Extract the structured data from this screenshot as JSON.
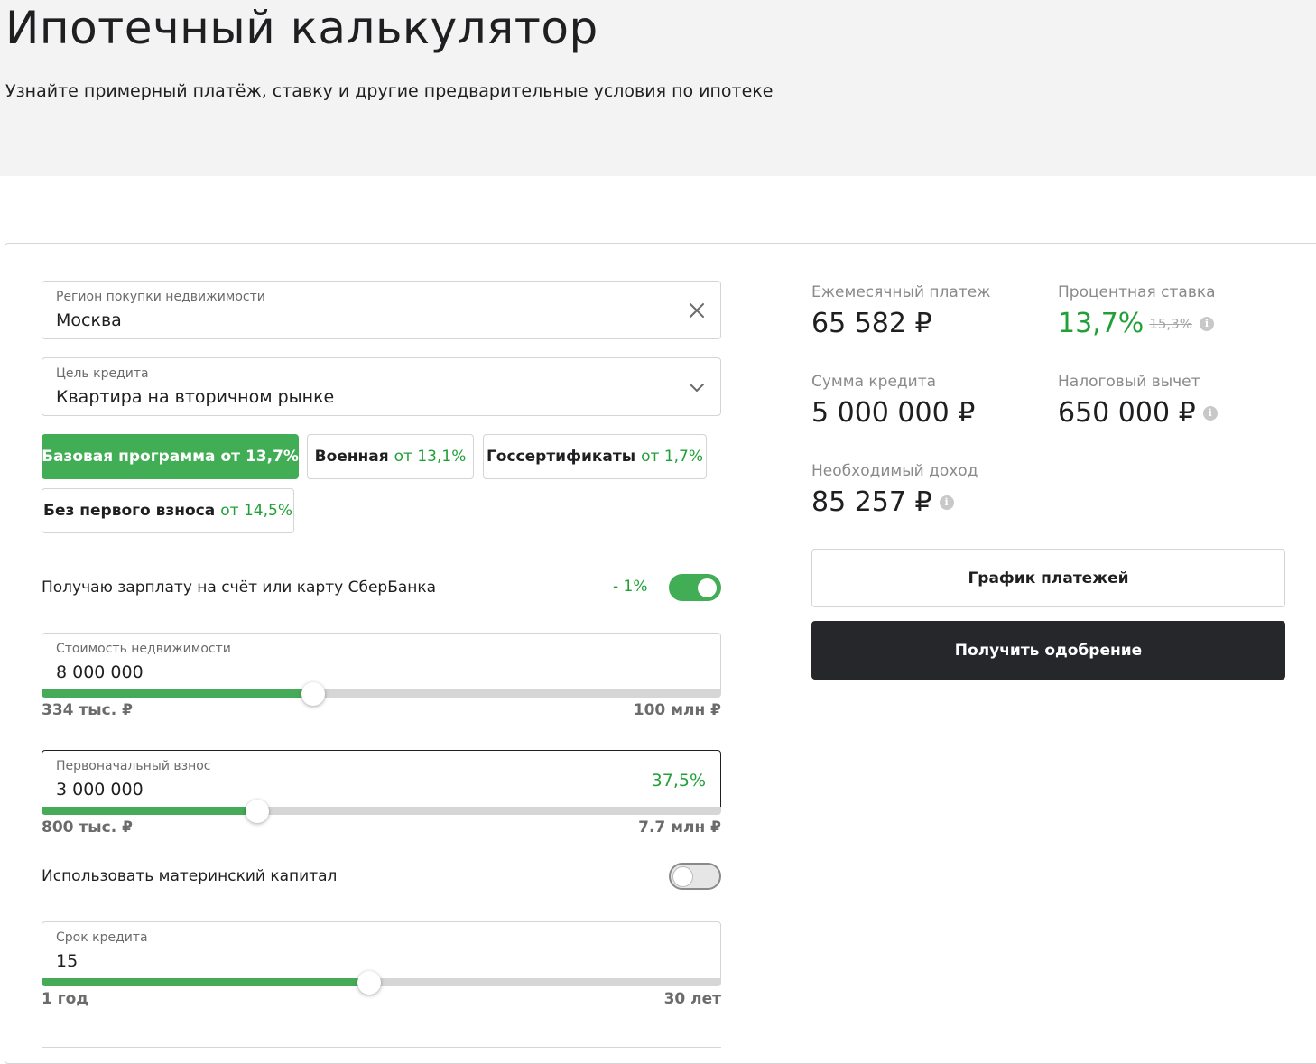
{
  "header": {
    "title": "Ипотечный калькулятор",
    "subtitle": "Узнайте примерный платёж, ставку и другие предварительные условия по ипотеке"
  },
  "form": {
    "region": {
      "label": "Регион покупки недвижимости",
      "value": "Москва",
      "icon": "close-icon"
    },
    "purpose": {
      "label": "Цель кредита",
      "value": "Квартира на вторичном рынке",
      "icon": "chevron-down-icon"
    },
    "programs": [
      {
        "name": "Базовая программа",
        "rate": "от 13,7%",
        "selected": true
      },
      {
        "name": "Военная",
        "rate": "от 13,1%",
        "selected": false
      },
      {
        "name": "Госсертификаты",
        "rate": "от 1,7%",
        "selected": false
      },
      {
        "name": "Без первого взноса",
        "rate": "от 14,5%",
        "selected": false
      }
    ],
    "salary": {
      "label": "Получаю зарплату на счёт или карту СберБанка",
      "discount": "- 1%",
      "on": true
    },
    "property_cost": {
      "label": "Стоимость недвижимости",
      "value": "8 000 000",
      "min": "334 тыс. ₽",
      "max": "100 млн ₽",
      "fraction": 0.4
    },
    "down_payment": {
      "label": "Первоначальный взнос",
      "value": "3 000 000",
      "percent": "37,5%",
      "min": "800 тыс. ₽",
      "max": "7.7 млн ₽",
      "fraction": 0.317
    },
    "maternity_capital": {
      "label": "Использовать материнский капитал",
      "on": false
    },
    "term": {
      "label": "Срок кредита",
      "value": "15",
      "min": "1 год",
      "max": "30 лет",
      "fraction": 0.482
    }
  },
  "results": {
    "monthly": {
      "label": "Ежемесячный платеж",
      "value": "65 582 ₽"
    },
    "rate": {
      "label": "Процентная ставка",
      "value": "13,7%",
      "old": "15,3%"
    },
    "loan_sum": {
      "label": "Сумма кредита",
      "value": "5 000 000 ₽"
    },
    "tax_deduction": {
      "label": "Налоговый вычет",
      "value": "650 000 ₽"
    },
    "income": {
      "label": "Необходимый доход",
      "value": "85 257 ₽"
    },
    "info_glyph": "i"
  },
  "buttons": {
    "schedule": "График платежей",
    "approval": "Получить одобрение"
  },
  "colors": {
    "accent": "#21a038",
    "dark": "#26272b"
  }
}
